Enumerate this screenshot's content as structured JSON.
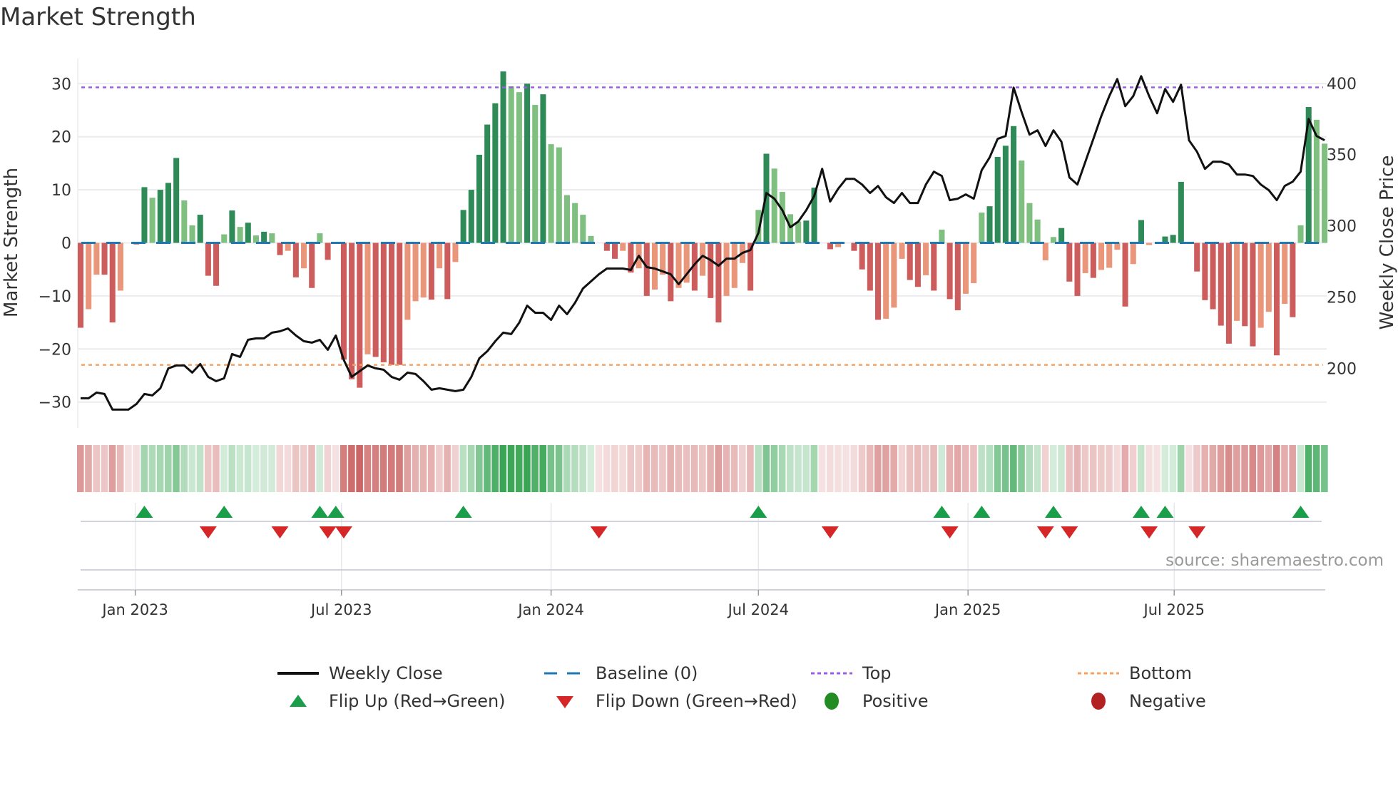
{
  "title": "Market Strength",
  "source": "source: sharemaestro.com",
  "legend": {
    "weekly_close": "Weekly Close",
    "baseline": "Baseline (0)",
    "top": "Top",
    "bottom": "Bottom",
    "flip_up": "Flip Up (Red→Green)",
    "flip_down": "Flip Down (Green→Red)",
    "positive": "Positive",
    "negative": "Negative"
  },
  "colors": {
    "bar_pos_dark": "#2e8b57",
    "bar_pos_light": "#7fbf7f",
    "bar_neg_dark": "#cd5c5c",
    "bar_neg_light": "#e9967a",
    "close": "#111111",
    "baseline": "#1f77b4",
    "top": "#9b5de5",
    "bottom": "#f4a261",
    "flip_up": "#1a9e4a",
    "flip_down": "#d62728",
    "positive": "#228b22",
    "negative": "#b22222"
  },
  "chart_data": {
    "type": "bar",
    "title": "Market Strength",
    "ylabel": "Market Strength",
    "y2label": "Weekly Close Price",
    "ylim": [
      -35,
      35
    ],
    "y2lim": [
      160,
      415
    ],
    "yticks": [
      "30",
      "20",
      "10",
      "0",
      "−10",
      "−20",
      "−30"
    ],
    "ytick_values": [
      30,
      20,
      10,
      0,
      -10,
      -20,
      -30
    ],
    "y2ticks": [
      "400",
      "350",
      "300",
      "250",
      "200"
    ],
    "y2tick_values": [
      400,
      350,
      300,
      250,
      200
    ],
    "xticks": [
      {
        "label": "Jan 2023",
        "date": "2023-01-01"
      },
      {
        "label": "Jul 2023",
        "date": "2023-07-01"
      },
      {
        "label": "Jan 2024",
        "date": "2024-01-01"
      },
      {
        "label": "Jul 2024",
        "date": "2024-07-01"
      },
      {
        "label": "Jan 2025",
        "date": "2025-01-01"
      },
      {
        "label": "Jul 2025",
        "date": "2025-07-01"
      }
    ],
    "start_date": "2022-11-14",
    "frequency": "weekly",
    "baseline": 0,
    "top": 29.3,
    "bottom": -23,
    "strength": [
      -16,
      -12.5,
      -6,
      -6,
      -15,
      -9,
      0,
      -0.3,
      10.5,
      8.5,
      10,
      11.3,
      16,
      8,
      3.3,
      5.3,
      -6.2,
      -8.1,
      1.6,
      6.1,
      3,
      3.8,
      1.4,
      2.1,
      1.8,
      -2.3,
      -1.5,
      -6.5,
      -4.8,
      -8.5,
      1.8,
      -3.2,
      0,
      -22,
      -25.7,
      -27.3,
      -21,
      -21.5,
      -22.5,
      -23,
      -23,
      -14.5,
      -11,
      -10.3,
      -10.7,
      -4.8,
      -10.6,
      -3.6,
      6.2,
      10,
      16.6,
      22.3,
      26.3,
      32.3,
      29.5,
      28.4,
      30,
      26,
      28,
      18.6,
      18,
      9,
      7.5,
      5.3,
      1.3,
      0,
      -1.5,
      -3,
      -1.5,
      -5.6,
      -4.8,
      -10,
      -8.8,
      -6,
      -11,
      -8.5,
      -7.5,
      -9,
      -6.2,
      -10.4,
      -15,
      -10,
      -8.5,
      -3.8,
      -9,
      6.2,
      16.8,
      14,
      9.6,
      5.4,
      4,
      4.2,
      10.4,
      0,
      -1.2,
      -0.8,
      0,
      -1.5,
      -5,
      -9,
      -14.5,
      -14.3,
      -12.2,
      -3,
      -7,
      -8.3,
      -6.1,
      -9,
      2.5,
      -10.6,
      -12.7,
      -9.6,
      -7.6,
      5.7,
      6.9,
      16.2,
      18.3,
      22,
      15.5,
      7.5,
      4.4,
      -3.3,
      1.1,
      2.8,
      -7.3,
      -10,
      -5.7,
      -6.6,
      -5.1,
      -4.7,
      -1.3,
      -12,
      -4,
      4.3,
      -0.4,
      0,
      1.2,
      1.5,
      11.5,
      0,
      -5.4,
      -10.8,
      -12.5,
      -15.6,
      -19,
      -14.7,
      -15.7,
      -19.5,
      -16,
      -13,
      -21.2,
      -11.5,
      -14,
      3.3,
      25.6,
      23.2,
      18.7
    ],
    "close": [
      179,
      179,
      183,
      182,
      171,
      171,
      171,
      175,
      182,
      181,
      186,
      200,
      202,
      202,
      197,
      203,
      194,
      191,
      193,
      210,
      208,
      220,
      221,
      221,
      225,
      226,
      228,
      223,
      219,
      218,
      220,
      213,
      223,
      206,
      194,
      198,
      202,
      200,
      199,
      194,
      192,
      197,
      196,
      191,
      185,
      186,
      185,
      184,
      185,
      194,
      207,
      212,
      219,
      225,
      224,
      232,
      244,
      239,
      239,
      234,
      244,
      238,
      246,
      256,
      261,
      266,
      270,
      270,
      270,
      269,
      279,
      271,
      270,
      268,
      266,
      259,
      266,
      273,
      279,
      276,
      272,
      277,
      277,
      281,
      283,
      295,
      323,
      319,
      311,
      299,
      303,
      311,
      321,
      340,
      317,
      326,
      333,
      333,
      329,
      323,
      328,
      320,
      316,
      323,
      316,
      316,
      329,
      338,
      335,
      318,
      319,
      322,
      319,
      339,
      348,
      361,
      363,
      397,
      380,
      364,
      367,
      356,
      367,
      359,
      334,
      329,
      345,
      361,
      377,
      391,
      403,
      384,
      391,
      405,
      391,
      379,
      396,
      387,
      399,
      360,
      352,
      340,
      345,
      345,
      343,
      336,
      336,
      335,
      329,
      325,
      318,
      328,
      331,
      338,
      375,
      363,
      360
    ],
    "flip_up_weeks": [
      8,
      18,
      30,
      32,
      48,
      85,
      108,
      113,
      122,
      133,
      136,
      153
    ],
    "flip_down_weeks": [
      16,
      25,
      31,
      33,
      65,
      94,
      109,
      121,
      124,
      134,
      140
    ]
  }
}
